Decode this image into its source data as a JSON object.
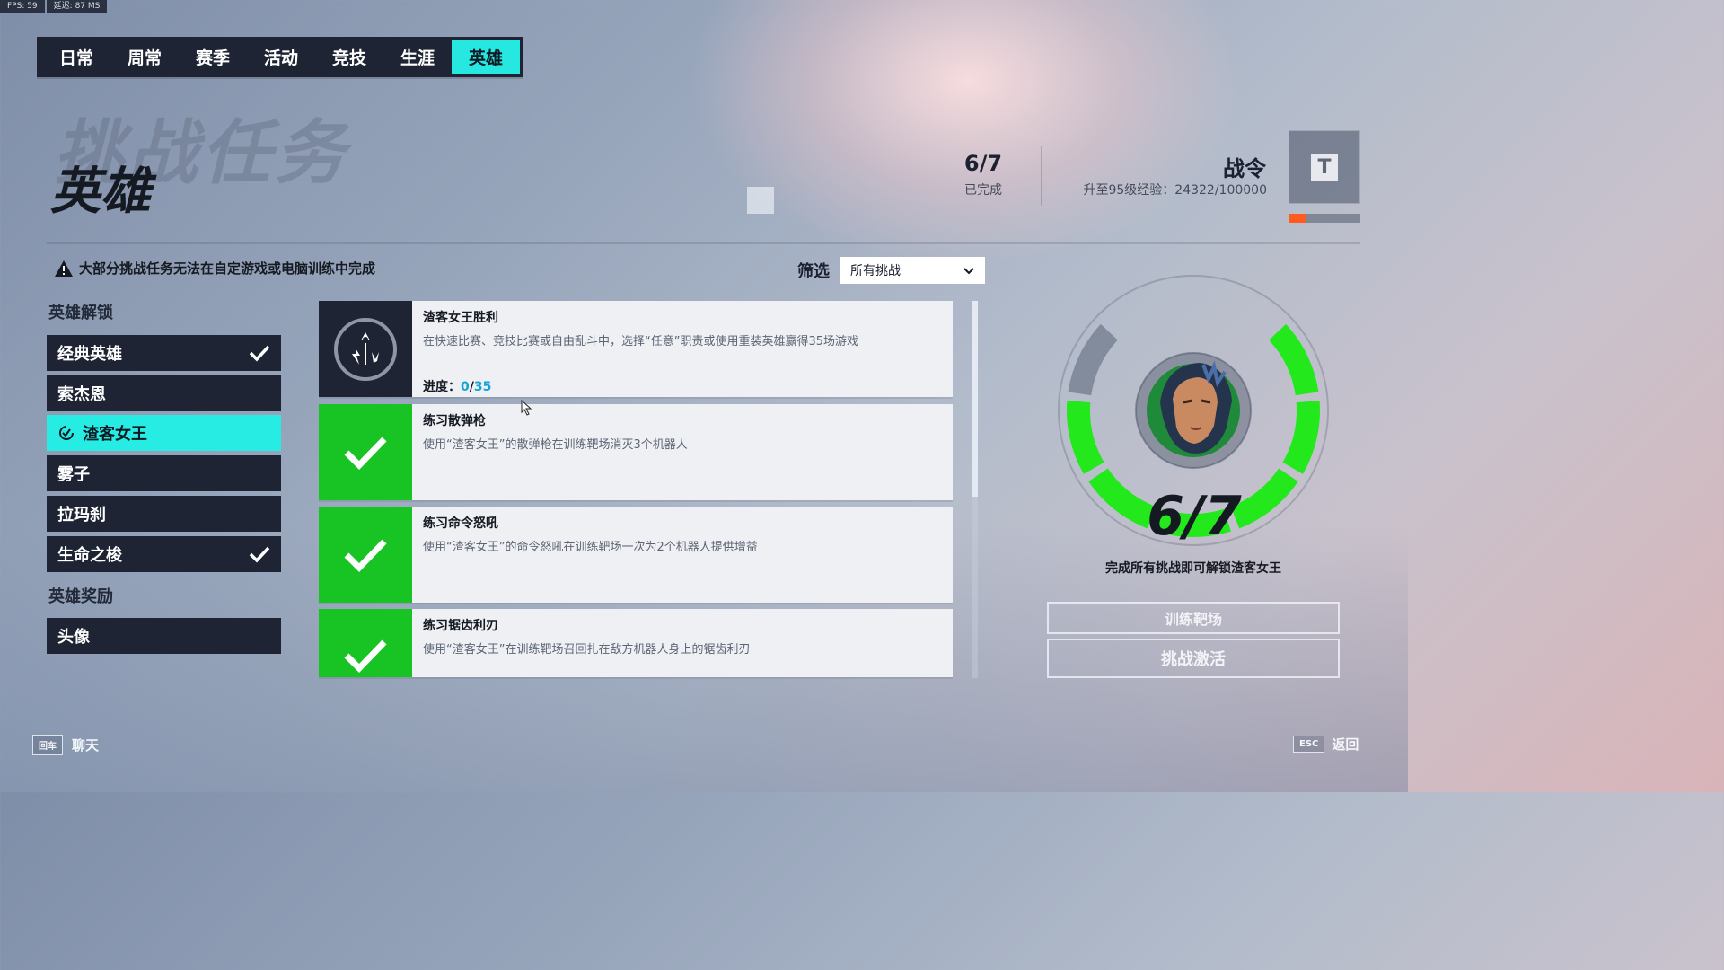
{
  "hud": {
    "fps": "FPS: 59",
    "latency": "延迟: 87 MS"
  },
  "tabs": [
    {
      "label": "日常",
      "active": false
    },
    {
      "label": "周常",
      "active": false
    },
    {
      "label": "赛季",
      "active": false
    },
    {
      "label": "活动",
      "active": false
    },
    {
      "label": "竞技",
      "active": false
    },
    {
      "label": "生涯",
      "active": false
    },
    {
      "label": "英雄",
      "active": true
    }
  ],
  "header": {
    "bg_title": "挑战任务",
    "title": "英雄",
    "completed_count": "6/7",
    "completed_label": "已完成",
    "battlepass_title": "战令",
    "battlepass_exp": "升至95级经验：24322/100000",
    "battlepass_tier_icon": "T",
    "battlepass_progress": 0.243
  },
  "warning": "大部分挑战任务无法在自定游戏或电脑训练中完成",
  "filter": {
    "label": "筛选",
    "value": "所有挑战"
  },
  "sidebar": {
    "unlock_heading": "英雄解锁",
    "items": [
      {
        "label": "经典英雄",
        "checked": true
      },
      {
        "label": "索杰恩",
        "checked": false
      },
      {
        "label": "渣客女王",
        "checked": false,
        "active": true
      },
      {
        "label": "雾子",
        "checked": false
      },
      {
        "label": "拉玛刹",
        "checked": false
      },
      {
        "label": "生命之梭",
        "checked": true
      }
    ],
    "reward_heading": "英雄奖励",
    "reward_items": [
      {
        "label": "头像"
      }
    ]
  },
  "challenges": [
    {
      "title": "渣客女王胜利",
      "desc": "在快速比赛、竞技比赛或自由乱斗中，选择“任意”职责或使用重装英雄赢得35场游戏",
      "progress_label": "进度：",
      "progress_current": "0",
      "progress_sep": "/",
      "progress_total": "35",
      "completed": false
    },
    {
      "title": "练习散弹枪",
      "desc": "使用“渣客女王”的散弹枪在训练靶场消灭3个机器人",
      "completed": true
    },
    {
      "title": "练习命令怒吼",
      "desc": "使用“渣客女王”的命令怒吼在训练靶场一次为2个机器人提供增益",
      "completed": true
    },
    {
      "title": "练习锯齿利刃",
      "desc": "使用“渣客女王”在训练靶场召回扎在敌方机器人身上的锯齿利刃",
      "completed": true
    }
  ],
  "hero_panel": {
    "count": "6/7",
    "message": "完成所有挑战即可解锁渣客女王",
    "segments_done": 6,
    "segments_total": 7,
    "button_training": "训练靶场",
    "button_activate": "挑战激活"
  },
  "footer": {
    "chat_key": "回车",
    "chat_label": "聊天",
    "back_key": "ESC",
    "back_label": "返回"
  },
  "colors": {
    "accent": "#26ece4",
    "complete": "#17c424",
    "ring": "#22e81c",
    "dark_panel": "#1e2433",
    "progress": "#ff5a1f"
  }
}
